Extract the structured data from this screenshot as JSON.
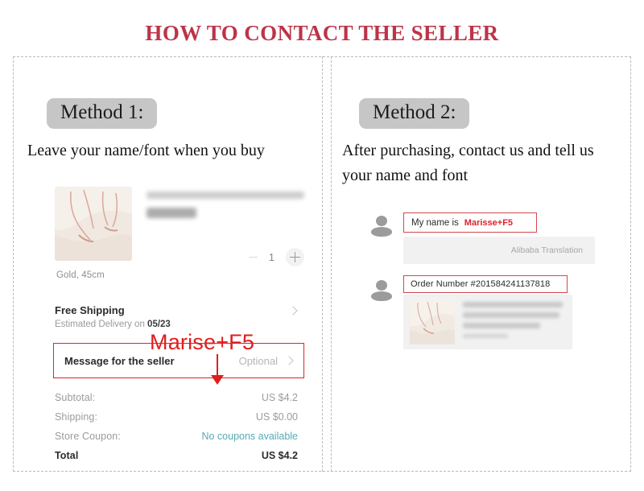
{
  "title": "HOW TO CONTACT THE SELLER",
  "colors": {
    "title_red": "#bc3448",
    "annotation_red": "#e21c1c",
    "box_red": "#d8252b",
    "badge_gray": "#c6c6c6",
    "link_teal": "#56aab3"
  },
  "methods": [
    {
      "badge": "Method 1:",
      "description": "Leave your name/font when you buy"
    },
    {
      "badge": "Method 2:",
      "description": "After purchasing, contact us and tell us your name and font"
    }
  ],
  "cart": {
    "product_title_blurred": "Personalized Name Necklace, Cu...",
    "product_price_blurred": "US $4.2",
    "variant": "Gold, 45cm",
    "quantity": "1",
    "minus_icon": "minus-icon",
    "plus_icon": "plus-icon",
    "shipping_title": "Free Shipping",
    "shipping_estimate_prefix": "Estimated Delivery on ",
    "shipping_estimate_date": "05/23",
    "message_label": "Message for the seller",
    "message_placeholder": "Optional",
    "annotation": "Marise+F5",
    "totals": [
      {
        "label": "Subtotal:",
        "value": "US $4.2",
        "link": false,
        "bold": false
      },
      {
        "label": "Shipping:",
        "value": "US $0.00",
        "link": false,
        "bold": false
      },
      {
        "label": "Store Coupon:",
        "value": "No coupons available",
        "link": true,
        "bold": false
      },
      {
        "label": "Total",
        "value": "US $4.2",
        "link": false,
        "bold": true
      }
    ]
  },
  "chat": {
    "message_name_prefix": "My name is",
    "message_name_value": "Marisse+F5",
    "translation_label": "Alibaba Translation",
    "order_message": "Order Number #201584241137818",
    "card_line_1_blurred": "Personalized Old English Fo",
    "card_line_2_blurred": "nt Name Necklace & Pen...",
    "card_line_3_blurred": "Pendant engraving",
    "card_line_4_blurred": "Size: 45cm"
  }
}
